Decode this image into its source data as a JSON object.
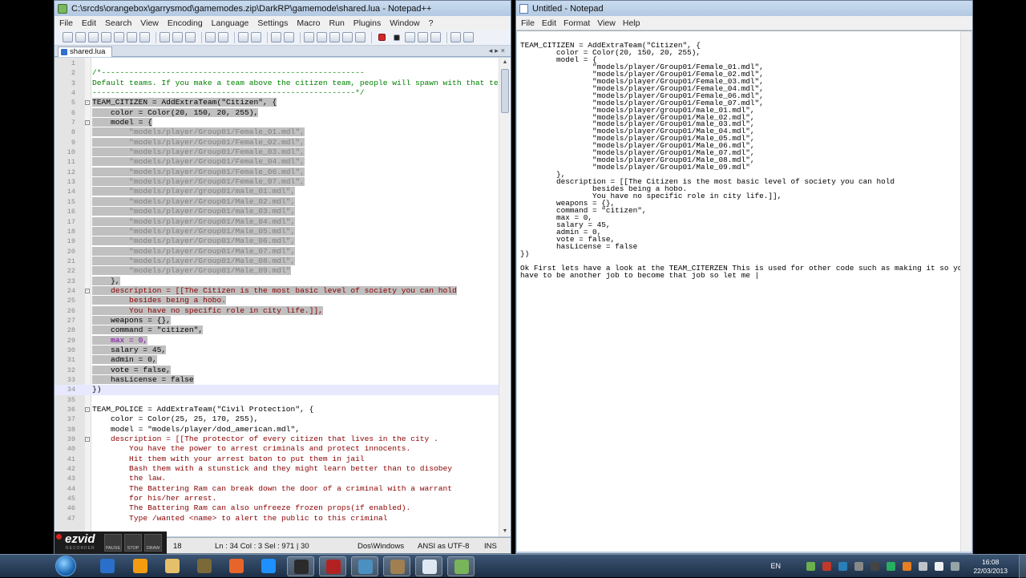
{
  "npp": {
    "title": "C:\\srcds\\orangebox\\garrysmod\\gamemodes.zip\\DarkRP\\gamemode\\shared.lua - Notepad++",
    "menu": [
      "File",
      "Edit",
      "Search",
      "View",
      "Encoding",
      "Language",
      "Settings",
      "Macro",
      "Run",
      "Plugins",
      "Window",
      "?"
    ],
    "tab": "shared.lua",
    "status": {
      "length": "18",
      "position": "Ln : 34    Col : 3    Sel : 971 | 30",
      "eol": "Dos\\Windows",
      "encoding": "ANSI as UTF-8",
      "mode": "INS"
    },
    "ezvid": {
      "brand": "ezvid",
      "sub": "RECORDER",
      "pause": "PAUSE",
      "stop": "STOP",
      "draw": "DRAW"
    },
    "lines": [
      {
        "n": "1",
        "t": "",
        "c": ""
      },
      {
        "n": "2",
        "t": "/*---------------------------------------------------------",
        "c": "comment"
      },
      {
        "n": "3",
        "t": "Default teams. If you make a team above the citizen team, people will spawn with that team!",
        "c": "comment"
      },
      {
        "n": "4",
        "t": "---------------------------------------------------------*/",
        "c": "comment"
      },
      {
        "n": "5",
        "t": "TEAM_CITIZEN = AddExtraTeam(\"Citizen\", {",
        "c": "",
        "sel": true,
        "m": "-"
      },
      {
        "n": "6",
        "t": "    color = Color(20, 150, 20, 255),",
        "c": "",
        "sel": true
      },
      {
        "n": "7",
        "t": "    model = {",
        "c": "",
        "sel": true,
        "m": "-"
      },
      {
        "n": "8",
        "t": "        \"models/player/Group01/Female_01.mdl\",",
        "c": "strc",
        "sel": true
      },
      {
        "n": "9",
        "t": "        \"models/player/Group01/Female_02.mdl\",",
        "c": "strc",
        "sel": true
      },
      {
        "n": "10",
        "t": "        \"models/player/Group01/Female_03.mdl\",",
        "c": "strc",
        "sel": true
      },
      {
        "n": "11",
        "t": "        \"models/player/Group01/Female_04.mdl\",",
        "c": "strc",
        "sel": true
      },
      {
        "n": "12",
        "t": "        \"models/player/Group01/Female_06.mdl\",",
        "c": "strc",
        "sel": true
      },
      {
        "n": "13",
        "t": "        \"models/player/Group01/Female_07.mdl\",",
        "c": "strc",
        "sel": true
      },
      {
        "n": "14",
        "t": "        \"models/player/group01/male_01.mdl\",",
        "c": "strc",
        "sel": true
      },
      {
        "n": "15",
        "t": "        \"models/player/Group01/Male_02.mdl\",",
        "c": "strc",
        "sel": true
      },
      {
        "n": "16",
        "t": "        \"models/player/Group01/male_03.mdl\",",
        "c": "strc",
        "sel": true
      },
      {
        "n": "17",
        "t": "        \"models/player/Group01/Male_04.mdl\",",
        "c": "strc",
        "sel": true
      },
      {
        "n": "18",
        "t": "        \"models/player/Group01/Male_05.mdl\",",
        "c": "strc",
        "sel": true
      },
      {
        "n": "19",
        "t": "        \"models/player/Group01/Male_06.mdl\",",
        "c": "strc",
        "sel": true
      },
      {
        "n": "20",
        "t": "        \"models/player/Group01/Male_07.mdl\",",
        "c": "strc",
        "sel": true
      },
      {
        "n": "21",
        "t": "        \"models/player/Group01/Male_08.mdl\",",
        "c": "strc",
        "sel": true
      },
      {
        "n": "22",
        "t": "        \"models/player/Group01/Male_09.mdl\"",
        "c": "strc",
        "sel": true
      },
      {
        "n": "23",
        "t": "    },",
        "c": "",
        "sel": true
      },
      {
        "n": "24",
        "t": "    description = [[The Citizen is the most basic level of society you can hold",
        "c": "dred",
        "sel": true,
        "m": "-"
      },
      {
        "n": "25",
        "t": "        besides being a hobo.",
        "c": "dred",
        "sel": true
      },
      {
        "n": "26",
        "t": "        You have no specific role in city life.]],",
        "c": "dred",
        "sel": true
      },
      {
        "n": "27",
        "t": "    weapons = {},",
        "c": "",
        "sel": true
      },
      {
        "n": "28",
        "t": "    command = \"citizen\",",
        "c": "",
        "sel": true
      },
      {
        "n": "29",
        "t": "    max = 0,",
        "c": "purple",
        "sel": true
      },
      {
        "n": "30",
        "t": "    salary = 45,",
        "c": "",
        "sel": true
      },
      {
        "n": "31",
        "t": "    admin = 0,",
        "c": "",
        "sel": true
      },
      {
        "n": "32",
        "t": "    vote = false,",
        "c": "",
        "sel": true
      },
      {
        "n": "33",
        "t": "    hasLicense = false",
        "c": "",
        "sel": true
      },
      {
        "n": "34",
        "t": "})",
        "c": "",
        "cur": true
      },
      {
        "n": "35",
        "t": "",
        "c": ""
      },
      {
        "n": "36",
        "t": "TEAM_POLICE = AddExtraTeam(\"Civil Protection\", {",
        "c": "",
        "m": "-"
      },
      {
        "n": "37",
        "t": "    color = Color(25, 25, 170, 255),",
        "c": ""
      },
      {
        "n": "38",
        "t": "    model = \"models/player/dod_american.mdl\",",
        "c": ""
      },
      {
        "n": "39",
        "t": "    description = [[The protector of every citizen that lives in the city .",
        "c": "dred",
        "m": "-"
      },
      {
        "n": "40",
        "t": "        You have the power to arrest criminals and protect innocents.",
        "c": "dred"
      },
      {
        "n": "41",
        "t": "        Hit them with your arrest baton to put them in jail",
        "c": "dred"
      },
      {
        "n": "42",
        "t": "        Bash them with a stunstick and they might learn better than to disobey",
        "c": "dred"
      },
      {
        "n": "43",
        "t": "        the law.",
        "c": "dred"
      },
      {
        "n": "44",
        "t": "        The Battering Ram can break down the door of a criminal with a warrant",
        "c": "dred"
      },
      {
        "n": "45",
        "t": "        for his/her arrest.",
        "c": "dred"
      },
      {
        "n": "46",
        "t": "        The Battering Ram can also unfreeze frozen props(if enabled).",
        "c": "dred"
      },
      {
        "n": "47",
        "t": "        Type /wanted <name> to alert the public to this criminal",
        "c": "dred"
      }
    ]
  },
  "notepad": {
    "title": "Untitled - Notepad",
    "menu": [
      "File",
      "Edit",
      "Format",
      "View",
      "Help"
    ],
    "text": "TEAM_CITIZEN = AddExtraTeam(\"Citizen\", {\n        color = Color(20, 150, 20, 255),\n        model = {\n                \"models/player/Group01/Female_01.mdl\",\n                \"models/player/Group01/Female_02.mdl\",\n                \"models/player/Group01/Female_03.mdl\",\n                \"models/player/Group01/Female_04.mdl\",\n                \"models/player/Group01/Female_06.mdl\",\n                \"models/player/Group01/Female_07.mdl\",\n                \"models/player/group01/male_01.mdl\",\n                \"models/player/Group01/Male_02.mdl\",\n                \"models/player/Group01/male_03.mdl\",\n                \"models/player/Group01/Male_04.mdl\",\n                \"models/player/Group01/Male_05.mdl\",\n                \"models/player/Group01/Male_06.mdl\",\n                \"models/player/Group01/Male_07.mdl\",\n                \"models/player/Group01/Male_08.mdl\",\n                \"models/player/Group01/Male_09.mdl\"\n        },\n        description = [[The Citizen is the most basic level of society you can hold\n                besides being a hobo.\n                You have no specific role in city life.]],\n        weapons = {},\n        command = \"citizen\",\n        max = 0,\n        salary = 45,\n        admin = 0,\n        vote = false,\n        hasLicense = false\n})\n\nOk First lets have a look at the TEAM_CITERZEN This is used for other code such as making it so you\nhave to be another job to become that job so let me |"
  },
  "taskbar": {
    "lang": "EN",
    "time": "16:08",
    "date": "22/03/2013",
    "apps": [
      "windows-explorer",
      "media-player",
      "folder",
      "winamp",
      "firefox",
      "internet-explorer",
      "steam",
      "filezilla",
      "network",
      "gimp",
      "notepad",
      "notepad-plus-plus"
    ]
  },
  "colors": {
    "selection": "#c0c0c0",
    "comment": "#008000",
    "string": "#808080",
    "description": "#8b0000"
  }
}
